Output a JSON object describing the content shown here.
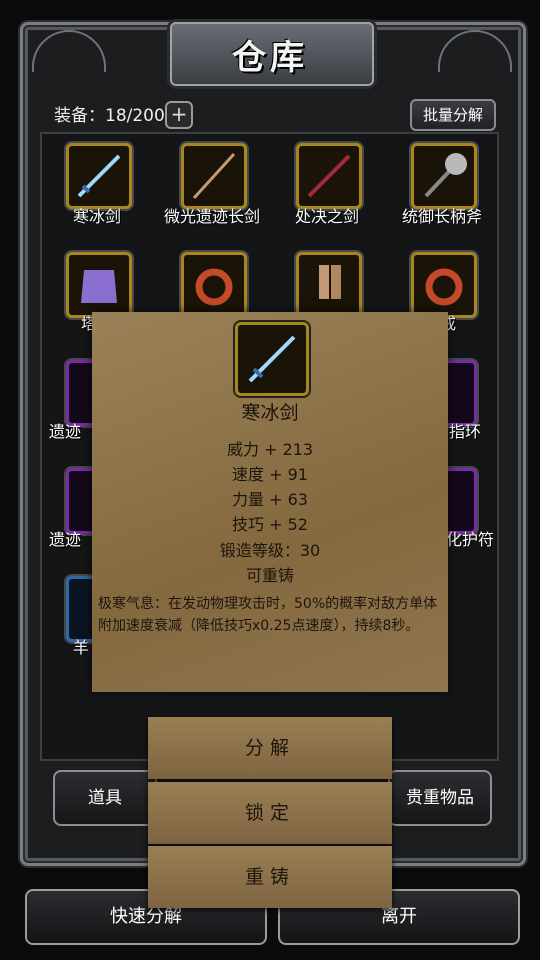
{
  "window": {
    "title": "仓库"
  },
  "header": {
    "equip_count": "装备：18/200",
    "batch_label": "批量分解"
  },
  "items": [
    {
      "name": "寒冰剑"
    },
    {
      "name": "微光遗迹长剑"
    },
    {
      "name": "处决之剑"
    },
    {
      "name": "统御长柄斧"
    },
    {
      "name": "塔拉"
    },
    {
      "name": "之戒"
    },
    {
      "name": "遗迹"
    },
    {
      "name": "指环"
    },
    {
      "name": "遗迹"
    },
    {
      "name": "化护符"
    },
    {
      "name": "羊"
    }
  ],
  "tabs": {
    "left": "道具",
    "right": "贵重物品"
  },
  "tooltip": {
    "name": "寒冰剑",
    "stats": [
      "威力 + 213",
      "速度 + 91",
      "力量 + 63",
      "技巧 + 52",
      "锻造等级：30",
      "可重铸"
    ],
    "description": "极寒气息：在发动物理攻击时，50%的概率对敌方单体附加速度衰减（降低技巧x0.25点速度），持续8秒。"
  },
  "actions": {
    "decompose": "分解",
    "lock": "锁定",
    "reforge": "重铸"
  },
  "footer": {
    "quick_decompose": "快速分解",
    "leave": "离开"
  },
  "colors": {
    "gold_border": "#a8861e",
    "purple_border": "#7b2aa8",
    "parchment": "#8e7650"
  }
}
